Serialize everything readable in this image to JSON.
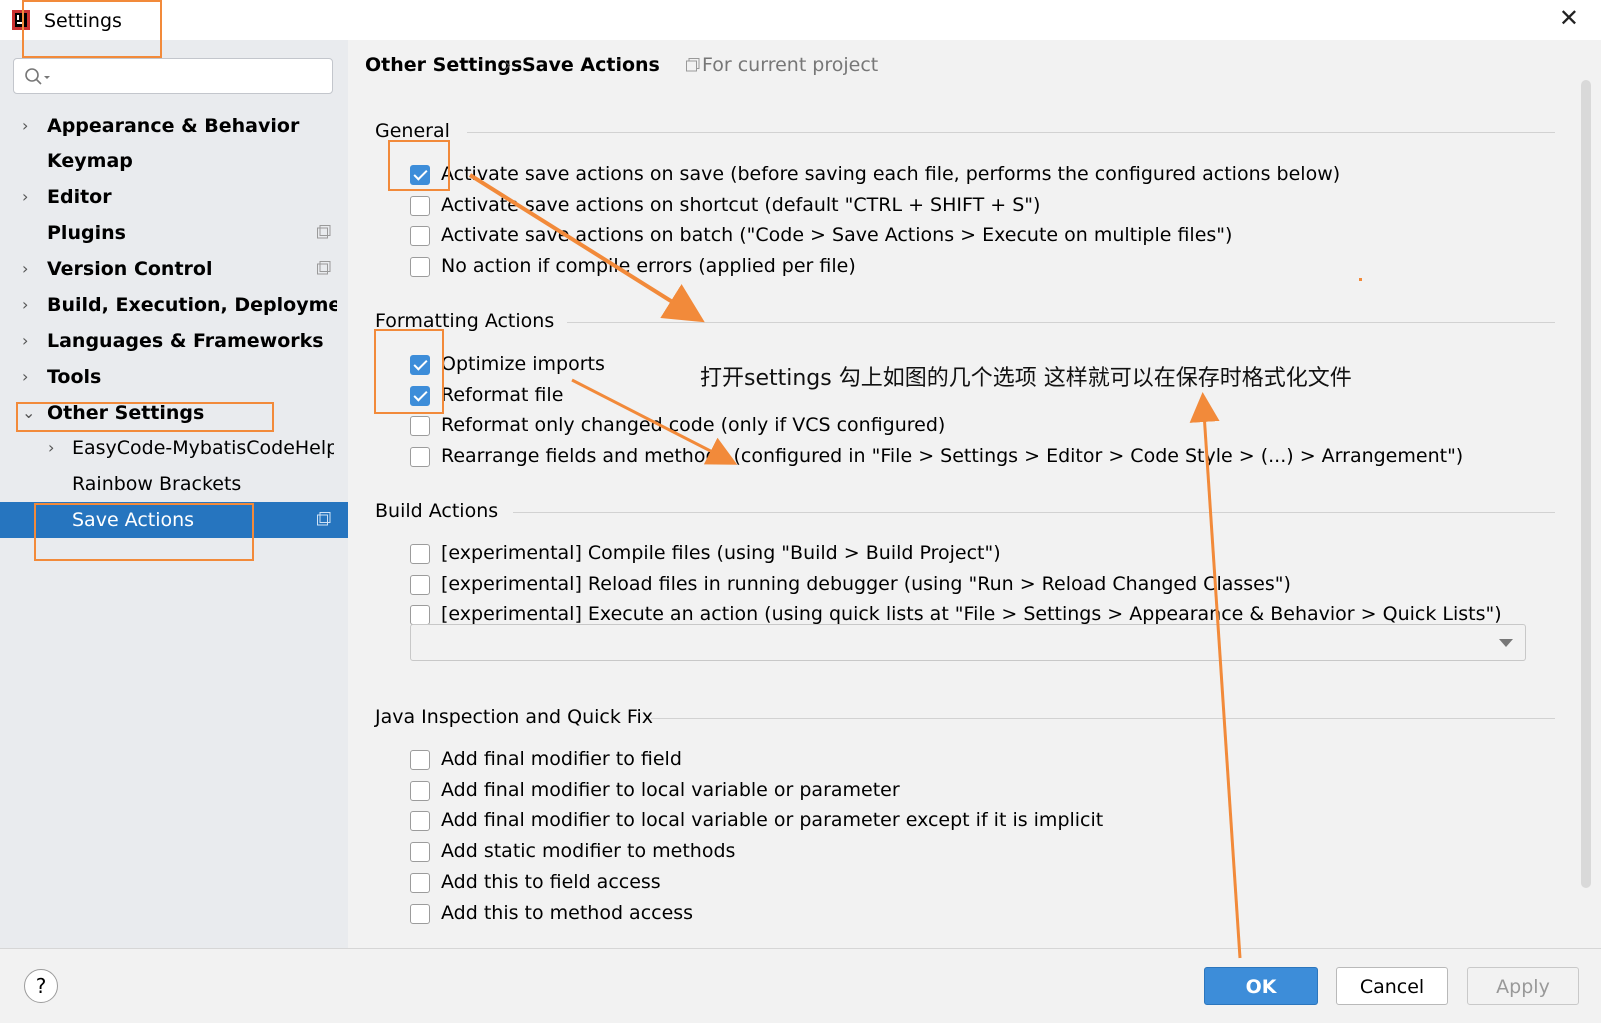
{
  "window": {
    "title": "Settings",
    "close": "✕"
  },
  "sidebar": {
    "items": [
      {
        "label": "Appearance & Behavior",
        "bold": true,
        "arrow": "›",
        "level": 0
      },
      {
        "label": "Keymap",
        "bold": true,
        "level": 0
      },
      {
        "label": "Editor",
        "bold": true,
        "arrow": "›",
        "level": 0
      },
      {
        "label": "Plugins",
        "bold": true,
        "level": 0,
        "copy": true
      },
      {
        "label": "Version Control",
        "bold": true,
        "arrow": "›",
        "level": 0,
        "copy": true
      },
      {
        "label": "Build, Execution, Deployment",
        "bold": true,
        "arrow": "›",
        "level": 0
      },
      {
        "label": "Languages & Frameworks",
        "bold": true,
        "arrow": "›",
        "level": 0
      },
      {
        "label": "Tools",
        "bold": true,
        "arrow": "›",
        "level": 0
      },
      {
        "label": "Other Settings",
        "bold": true,
        "arrow": "⌄",
        "level": 0
      },
      {
        "label": "EasyCode-MybatisCodeHelper",
        "arrow": "›",
        "level": 1
      },
      {
        "label": "Rainbow Brackets",
        "level": 1
      },
      {
        "label": "Save Actions",
        "level": 1,
        "selected": true,
        "copy": true
      }
    ]
  },
  "breadcrumb": {
    "parent": "Other Settings",
    "separator": "›",
    "current": "Save Actions",
    "scope": "For current project"
  },
  "sections": {
    "general": {
      "title": "General",
      "options": [
        {
          "label": "Activate save actions on save (before saving each file, performs the configured actions below)",
          "checked": true
        },
        {
          "label": "Activate save actions on shortcut (default \"CTRL + SHIFT + S\")",
          "checked": false
        },
        {
          "label": "Activate save actions on batch (\"Code > Save Actions > Execute on multiple files\")",
          "checked": false
        },
        {
          "label": "No action if compile errors (applied per file)",
          "checked": false
        }
      ]
    },
    "formatting": {
      "title": "Formatting Actions",
      "options": [
        {
          "label": "Optimize imports",
          "checked": true
        },
        {
          "label": "Reformat file",
          "checked": true
        },
        {
          "label": "Reformat only changed code (only if VCS configured)",
          "checked": false
        },
        {
          "label": "Rearrange fields and methods (configured in \"File > Settings > Editor > Code Style > (...) > Arrangement\")",
          "checked": false
        }
      ]
    },
    "build": {
      "title": "Build Actions",
      "options": [
        {
          "label": "[experimental] Compile files (using \"Build > Build Project\")",
          "checked": false
        },
        {
          "label": "[experimental] Reload files in running debugger (using \"Run > Reload Changed Classes\")",
          "checked": false
        },
        {
          "label": "[experimental] Execute an action (using quick lists at \"File > Settings > Appearance & Behavior > Quick Lists\")",
          "checked": false
        }
      ],
      "combo_value": ""
    },
    "java": {
      "title": "Java Inspection and Quick Fix",
      "options": [
        {
          "label": "Add final modifier to field",
          "checked": false
        },
        {
          "label": "Add final modifier to local variable or parameter",
          "checked": false
        },
        {
          "label": "Add final modifier to local variable or parameter except if it is implicit",
          "checked": false
        },
        {
          "label": "Add static modifier to methods",
          "checked": false
        },
        {
          "label": "Add this to field access",
          "checked": false
        },
        {
          "label": "Add this to method access",
          "checked": false
        }
      ]
    }
  },
  "annotation": {
    "text": "打开settings 勾上如图的几个选项 这样就可以在保存时格式化文件",
    "color": "#f28a3a"
  },
  "footer": {
    "help": "?",
    "ok": "OK",
    "cancel": "Cancel",
    "apply": "Apply"
  }
}
